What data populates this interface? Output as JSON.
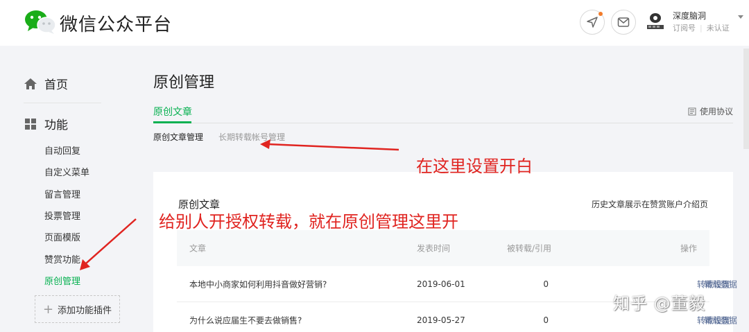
{
  "header": {
    "brand": "微信公众平台",
    "account_name": "深度脑洞",
    "account_type": "订阅号",
    "account_status": "未认证",
    "notice_color": "#f27b2a"
  },
  "sidebar": {
    "home": "首页",
    "func": "功能",
    "items": [
      "自动回复",
      "自定义菜单",
      "留言管理",
      "投票管理",
      "页面模版",
      "赞赏功能",
      "原创管理"
    ],
    "active_index": 6,
    "add_plugin": "添加功能插件"
  },
  "main": {
    "title": "原创管理",
    "tab": "原创文章",
    "usage": "使用协议",
    "subtabs": [
      "原创文章管理",
      "长期转载帐号管理"
    ],
    "card_title": "原创文章",
    "card_link": "历史文章展示在赞赏账户介绍页",
    "columns": [
      "文章",
      "发表时间",
      "被转载/引用",
      "操作"
    ],
    "rows": [
      {
        "title": "本地中小商家如何利用抖音做好营销?",
        "date": "2019-06-01",
        "count": "0",
        "op1": "转载设置",
        "op2": "转载数据"
      },
      {
        "title": "为什么说应届生不要去做销售?",
        "date": "2019-05-27",
        "count": "0",
        "op1": "转载设置",
        "op2": "转载数据"
      }
    ]
  },
  "annotations": {
    "a1": "在这里设置开白",
    "a2": "给别人开授权转载，就在原创管理这里开",
    "color": "#e02420"
  },
  "watermark": "知乎 @董毅",
  "colors": {
    "accent": "#07b151",
    "link": "#576b95"
  }
}
